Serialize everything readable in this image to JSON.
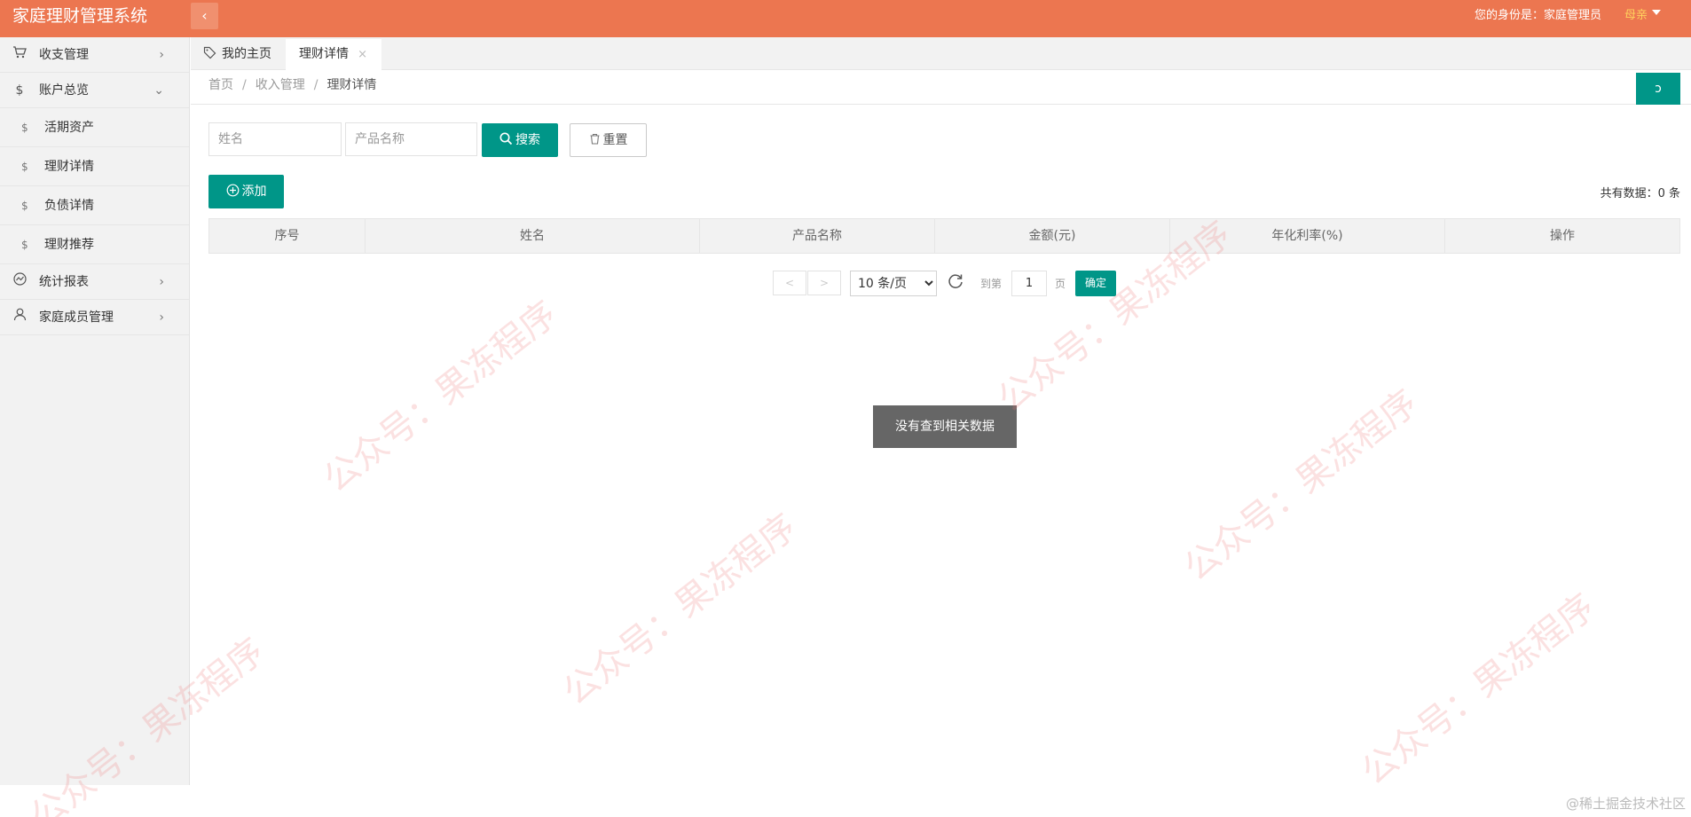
{
  "header": {
    "app_title": "家庭理财管理系统",
    "collapse_icon": "‹",
    "identity_text": "您的身份是：家庭管理员",
    "user_name": "母亲"
  },
  "sidebar": {
    "items": [
      {
        "label": "收支管理",
        "icon": "cart-icon",
        "arrow": "›"
      },
      {
        "label": "账户总览",
        "icon": "dollar-icon",
        "arrow": "⌄"
      },
      {
        "label": "活期资产",
        "icon": "$"
      },
      {
        "label": "理财详情",
        "icon": "$"
      },
      {
        "label": "负债详情",
        "icon": "$"
      },
      {
        "label": "理财推荐",
        "icon": "$"
      },
      {
        "label": "统计报表",
        "icon": "chart-icon",
        "arrow": "›"
      },
      {
        "label": "家庭成员管理",
        "icon": "user-icon",
        "arrow": "›"
      }
    ]
  },
  "tabs": {
    "home": "我的主页",
    "active": "理财详情",
    "close": "×"
  },
  "breadcrumb": {
    "items": [
      "首页",
      "收入管理",
      "理财详情"
    ],
    "separator": "/"
  },
  "refresh_label": "ↄ",
  "search": {
    "name_placeholder": "姓名",
    "product_placeholder": "产品名称",
    "search_label": "搜索",
    "reset_label": "重置"
  },
  "toolbar": {
    "add_label": "添加",
    "total_text": "共有数据：0 条"
  },
  "table": {
    "columns": [
      "序号",
      "姓名",
      "产品名称",
      "金额(元)",
      "年化利率(%)",
      "操作"
    ]
  },
  "pagination": {
    "prev": "<",
    "next": ">",
    "limit_options": [
      "10 条/页"
    ],
    "goto_label": "到第",
    "page_value": "1",
    "page_suffix": "页",
    "confirm_label": "确定"
  },
  "empty_message": "没有查到相关数据",
  "watermark": "公众号：果冻程序",
  "footer_mark": "@稀土掘金技术社区",
  "colors": {
    "header": "#ec7650",
    "primary": "#009688",
    "toast": "#666666"
  }
}
